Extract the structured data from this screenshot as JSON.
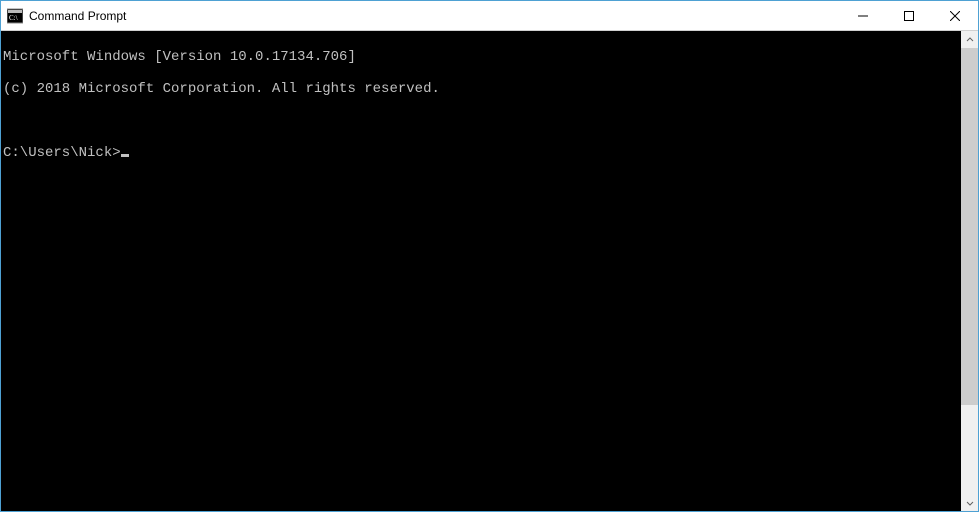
{
  "window": {
    "title": "Command Prompt"
  },
  "terminal": {
    "line1": "Microsoft Windows [Version 10.0.17134.706]",
    "line2": "(c) 2018 Microsoft Corporation. All rights reserved.",
    "blank": "",
    "prompt": "C:\\Users\\Nick>"
  }
}
